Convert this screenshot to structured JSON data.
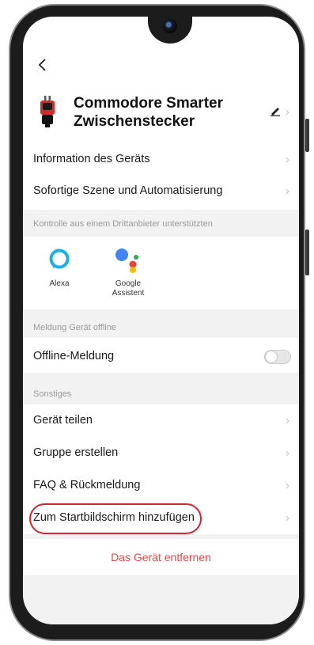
{
  "device": {
    "name_line1": "Commodore Smarter",
    "name_line2": "Zwischenstecker"
  },
  "menu_top": [
    {
      "label": "Information des Geräts"
    },
    {
      "label": "Sofortige Szene und Automatisierung"
    }
  ],
  "third_party": {
    "title": "Kontrolle aus einem Drittanbieter unterstützten",
    "alexa": "Alexa",
    "google_line1": "Google",
    "google_line2": "Assistent"
  },
  "offline": {
    "title": "Meldung Gerät offline",
    "label": "Offline-Meldung",
    "enabled": false
  },
  "other": {
    "title": "Sonstiges",
    "items": [
      {
        "label": "Gerät teilen"
      },
      {
        "label": "Gruppe erstellen"
      },
      {
        "label": "FAQ & Rückmeldung"
      },
      {
        "label": "Zum Startbildschirm hinzufügen"
      }
    ]
  },
  "remove_label": "Das Gerät entfernen",
  "colors": {
    "accent_red": "#e34a46",
    "highlight_red": "#d6252c",
    "alexa_blue": "#1ab0e8",
    "section_gray": "#f2f2f2"
  },
  "icons": {
    "back": "chevron-left-icon",
    "edit": "pencil-icon",
    "more": "chevron-right-icon",
    "alexa": "alexa-ring-icon",
    "google": "google-assistant-dots-icon"
  }
}
